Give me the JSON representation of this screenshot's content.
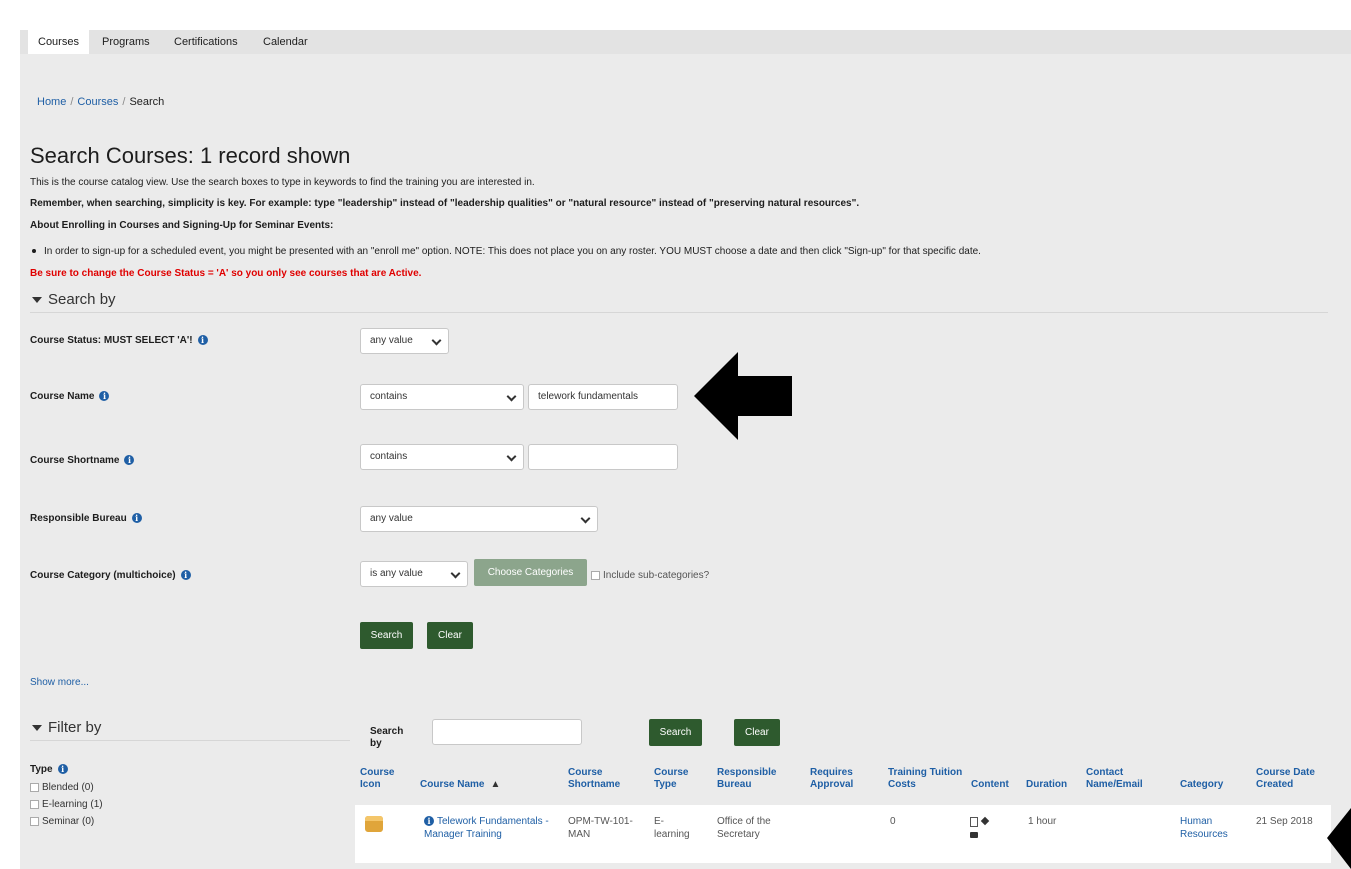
{
  "nav": {
    "tabs": [
      "Courses",
      "Programs",
      "Certifications",
      "Calendar"
    ],
    "active": 0
  },
  "breadcrumb": {
    "home": "Home",
    "courses": "Courses",
    "current": "Search"
  },
  "page": {
    "title": "Search Courses: 1 record shown",
    "intro": "This is the course catalog view.  Use the search boxes to type in keywords to find the training you are interested in.",
    "remember": "Remember, when searching, simplicity is key.  For example: type \"leadership\" instead of \"leadership qualities\" or \"natural resource\" instead of \"preserving natural resources\".",
    "about": "About Enrolling in Courses and Signing-Up for Seminar Events:",
    "bullet": "In order to sign-up for a scheduled event, you might be presented with an \"enroll me\" option. NOTE:  This does not place you on any roster.  YOU MUST choose a date and then click \"Sign-up\" for that specific date.",
    "warning": "Be sure to change the Course Status = 'A' so you only see courses that are Active."
  },
  "search_by": {
    "heading": "Search by",
    "status": {
      "label": "Course Status: MUST SELECT 'A'!",
      "value": "any value"
    },
    "name": {
      "label": "Course Name",
      "operator": "contains",
      "value": "telework fundamentals"
    },
    "shortname": {
      "label": "Course Shortname",
      "operator": "contains",
      "value": ""
    },
    "bureau": {
      "label": "Responsible Bureau",
      "value": "any value"
    },
    "category": {
      "label": "Course Category (multichoice)",
      "operator": "is any value",
      "choose": "Choose Categories",
      "subcats": "Include sub-categories?"
    },
    "search_btn": "Search",
    "clear_btn": "Clear",
    "show_more": "Show more..."
  },
  "filter_by": {
    "heading": "Filter by",
    "type_label": "Type",
    "options": [
      "Blended (0)",
      "E-learning (1)",
      "Seminar (0)"
    ]
  },
  "table": {
    "search_by_label": "Search by",
    "search_value": "",
    "search_btn": "Search",
    "clear_btn": "Clear",
    "headers": {
      "icon": "Course Icon",
      "name": "Course Name",
      "shortname": "Course Shortname",
      "type": "Course Type",
      "bureau": "Responsible Bureau",
      "approval": "Requires Approval",
      "costs": "Training Tuition Costs",
      "content": "Content",
      "duration": "Duration",
      "contact": "Contact Name/Email",
      "category": "Category",
      "date": "Course Date Created"
    },
    "row": {
      "name": "Telework Fundamentals - Manager Training",
      "shortname": "OPM-TW-101-MAN",
      "type": "E-learning",
      "bureau": "Office of the Secretary",
      "approval": "",
      "costs": "0",
      "duration": "1 hour",
      "contact": "",
      "category": "Human Resources",
      "date": "21 Sep 2018"
    }
  },
  "colors": {
    "accent_green": "#2e5a2e",
    "link_blue": "#1f5fa5",
    "warning_red": "#e00000"
  }
}
